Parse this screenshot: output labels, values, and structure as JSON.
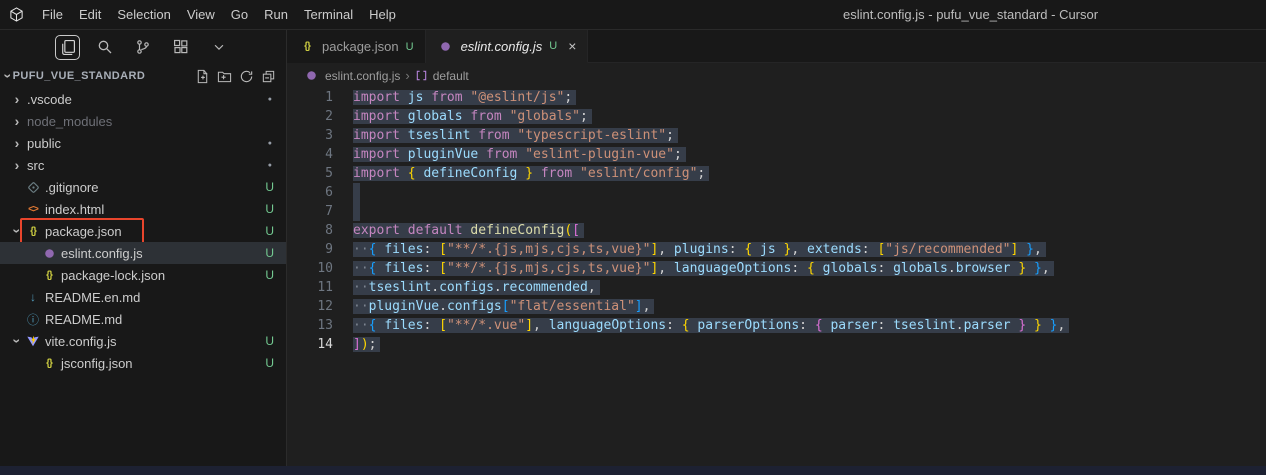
{
  "title_bar": {
    "menus": [
      "File",
      "Edit",
      "Selection",
      "View",
      "Go",
      "Run",
      "Terminal",
      "Help"
    ],
    "window_title": "eslint.config.js - pufu_vue_standard - Cursor"
  },
  "activity": {
    "items": [
      {
        "name": "files",
        "active": true
      },
      {
        "name": "search",
        "active": false
      },
      {
        "name": "source-control",
        "active": false
      },
      {
        "name": "extensions",
        "active": false
      },
      {
        "name": "chevron-down",
        "active": false
      }
    ]
  },
  "explorer": {
    "root_label": "PUFU_VUE_STANDARD",
    "actions": [
      "new-file",
      "new-folder",
      "refresh",
      "collapse-all"
    ],
    "items": [
      {
        "label": ".vscode",
        "type": "folder",
        "chevron": "collapsed",
        "badge": "dot",
        "indent": 0
      },
      {
        "label": "node_modules",
        "type": "folder",
        "chevron": "collapsed",
        "dimmed": true,
        "indent": 0
      },
      {
        "label": "public",
        "type": "folder",
        "chevron": "collapsed",
        "badge": "dot",
        "indent": 0
      },
      {
        "label": "src",
        "type": "folder",
        "chevron": "collapsed",
        "badge": "dot",
        "indent": 0
      },
      {
        "label": ".gitignore",
        "type": "file",
        "icon": "git",
        "badge": "U",
        "indent": 0
      },
      {
        "label": "index.html",
        "type": "file",
        "icon": "html",
        "badge": "U",
        "indent": 0
      },
      {
        "label": "package.json",
        "type": "file",
        "icon": "json",
        "chevron": "expanded",
        "badge": "U",
        "indent": 0,
        "annotated": true
      },
      {
        "label": "eslint.config.js",
        "type": "file",
        "icon": "eslint",
        "badge": "U",
        "indent": 1,
        "selected": true
      },
      {
        "label": "package-lock.json",
        "type": "file",
        "icon": "json",
        "badge": "U",
        "indent": 1
      },
      {
        "label": "README.en.md",
        "type": "file",
        "icon": "markdown",
        "indent": 0
      },
      {
        "label": "README.md",
        "type": "file",
        "icon": "info",
        "indent": 0
      },
      {
        "label": "vite.config.js",
        "type": "file",
        "icon": "vite",
        "chevron": "expanded",
        "badge": "U",
        "indent": 0
      },
      {
        "label": "jsconfig.json",
        "type": "file",
        "icon": "json",
        "badge": "U",
        "indent": 1
      }
    ]
  },
  "tabs": [
    {
      "label": "package.json",
      "icon": "json",
      "badge": "U",
      "active": false
    },
    {
      "label": "eslint.config.js",
      "icon": "eslint",
      "badge": "U",
      "active": true
    }
  ],
  "breadcrumb": {
    "file": "eslint.config.js",
    "symbol": "default"
  },
  "editor": {
    "active_line": 14,
    "lines": [
      {
        "n": 1,
        "tokens": [
          [
            "kw",
            "import "
          ],
          [
            "var",
            "js"
          ],
          [
            "kw",
            " from "
          ],
          [
            "str",
            "\"@eslint/js\""
          ],
          [
            "pun",
            ";"
          ]
        ]
      },
      {
        "n": 2,
        "tokens": [
          [
            "kw",
            "import "
          ],
          [
            "var",
            "globals"
          ],
          [
            "kw",
            " from "
          ],
          [
            "str",
            "\"globals\""
          ],
          [
            "pun",
            ";"
          ]
        ]
      },
      {
        "n": 3,
        "tokens": [
          [
            "kw",
            "import "
          ],
          [
            "var",
            "tseslint"
          ],
          [
            "kw",
            " from "
          ],
          [
            "str",
            "\"typescript-eslint\""
          ],
          [
            "pun",
            ";"
          ]
        ]
      },
      {
        "n": 4,
        "tokens": [
          [
            "kw",
            "import "
          ],
          [
            "var",
            "pluginVue"
          ],
          [
            "kw",
            " from "
          ],
          [
            "str",
            "\"eslint-plugin-vue\""
          ],
          [
            "pun",
            ";"
          ]
        ]
      },
      {
        "n": 5,
        "tokens": [
          [
            "kw",
            "import "
          ],
          [
            "b1",
            "{"
          ],
          [
            "pun",
            " "
          ],
          [
            "var",
            "defineConfig"
          ],
          [
            "pun",
            " "
          ],
          [
            "b1",
            "}"
          ],
          [
            "kw",
            " from "
          ],
          [
            "str",
            "\"eslint/config\""
          ],
          [
            "pun",
            ";"
          ]
        ]
      },
      {
        "n": 6,
        "tokens": []
      },
      {
        "n": 7,
        "tokens": []
      },
      {
        "n": 8,
        "tokens": [
          [
            "kw",
            "export "
          ],
          [
            "kw",
            "default "
          ],
          [
            "fn",
            "defineConfig"
          ],
          [
            "b1",
            "("
          ],
          [
            "b2",
            "["
          ]
        ]
      },
      {
        "n": 9,
        "tokens": [
          [
            "ws",
            "··"
          ],
          [
            "b3",
            "{"
          ],
          [
            "pun",
            " "
          ],
          [
            "prop",
            "files"
          ],
          [
            "pun",
            ": "
          ],
          [
            "b1",
            "["
          ],
          [
            "str",
            "\"**/*.{js,mjs,cjs,ts,vue}\""
          ],
          [
            "b1",
            "]"
          ],
          [
            "pun",
            ", "
          ],
          [
            "prop",
            "plugins"
          ],
          [
            "pun",
            ": "
          ],
          [
            "b1",
            "{"
          ],
          [
            "pun",
            " "
          ],
          [
            "var",
            "js"
          ],
          [
            "pun",
            " "
          ],
          [
            "b1",
            "}"
          ],
          [
            "pun",
            ", "
          ],
          [
            "prop",
            "extends"
          ],
          [
            "pun",
            ": "
          ],
          [
            "b1",
            "["
          ],
          [
            "str",
            "\"js/recommended\""
          ],
          [
            "b1",
            "]"
          ],
          [
            "pun",
            " "
          ],
          [
            "b3",
            "}"
          ],
          [
            "pun",
            ","
          ]
        ]
      },
      {
        "n": 10,
        "tokens": [
          [
            "ws",
            "··"
          ],
          [
            "b3",
            "{"
          ],
          [
            "pun",
            " "
          ],
          [
            "prop",
            "files"
          ],
          [
            "pun",
            ": "
          ],
          [
            "b1",
            "["
          ],
          [
            "str",
            "\"**/*.{js,mjs,cjs,ts,vue}\""
          ],
          [
            "b1",
            "]"
          ],
          [
            "pun",
            ", "
          ],
          [
            "prop",
            "languageOptions"
          ],
          [
            "pun",
            ": "
          ],
          [
            "b1",
            "{"
          ],
          [
            "pun",
            " "
          ],
          [
            "prop",
            "globals"
          ],
          [
            "pun",
            ": "
          ],
          [
            "var",
            "globals"
          ],
          [
            "pun",
            "."
          ],
          [
            "prop",
            "browser"
          ],
          [
            "pun",
            " "
          ],
          [
            "b1",
            "}"
          ],
          [
            "pun",
            " "
          ],
          [
            "b3",
            "}"
          ],
          [
            "pun",
            ","
          ]
        ]
      },
      {
        "n": 11,
        "tokens": [
          [
            "ws",
            "··"
          ],
          [
            "var",
            "tseslint"
          ],
          [
            "pun",
            "."
          ],
          [
            "prop",
            "configs"
          ],
          [
            "pun",
            "."
          ],
          [
            "prop",
            "recommended"
          ],
          [
            "pun",
            ","
          ]
        ]
      },
      {
        "n": 12,
        "tokens": [
          [
            "ws",
            "··"
          ],
          [
            "var",
            "pluginVue"
          ],
          [
            "pun",
            "."
          ],
          [
            "prop",
            "configs"
          ],
          [
            "b3",
            "["
          ],
          [
            "str",
            "\"flat/essential\""
          ],
          [
            "b3",
            "]"
          ],
          [
            "pun",
            ","
          ]
        ]
      },
      {
        "n": 13,
        "tokens": [
          [
            "ws",
            "··"
          ],
          [
            "b3",
            "{"
          ],
          [
            "pun",
            " "
          ],
          [
            "prop",
            "files"
          ],
          [
            "pun",
            ": "
          ],
          [
            "b1",
            "["
          ],
          [
            "str",
            "\"**/*.vue\""
          ],
          [
            "b1",
            "]"
          ],
          [
            "pun",
            ", "
          ],
          [
            "prop",
            "languageOptions"
          ],
          [
            "pun",
            ": "
          ],
          [
            "b1",
            "{"
          ],
          [
            "pun",
            " "
          ],
          [
            "prop",
            "parserOptions"
          ],
          [
            "pun",
            ": "
          ],
          [
            "b2",
            "{"
          ],
          [
            "pun",
            " "
          ],
          [
            "prop",
            "parser"
          ],
          [
            "pun",
            ": "
          ],
          [
            "var",
            "tseslint"
          ],
          [
            "pun",
            "."
          ],
          [
            "prop",
            "parser"
          ],
          [
            "pun",
            " "
          ],
          [
            "b2",
            "}"
          ],
          [
            "pun",
            " "
          ],
          [
            "b1",
            "}"
          ],
          [
            "pun",
            " "
          ],
          [
            "b3",
            "}"
          ],
          [
            "pun",
            ","
          ]
        ]
      },
      {
        "n": 14,
        "tokens": [
          [
            "b2",
            "]"
          ],
          [
            "b1",
            ")"
          ],
          [
            "pun",
            ";"
          ]
        ]
      }
    ]
  },
  "colors": {
    "untracked_badge": "#73C991",
    "annotation_box": "#E8452C",
    "selection": "#363D49",
    "eslint_purple": "#9068B0",
    "html_orange": "#E37933",
    "json_yellow": "#CBCB41",
    "markdown_blue": "#519ABA",
    "status_bar": "#1D2132"
  }
}
